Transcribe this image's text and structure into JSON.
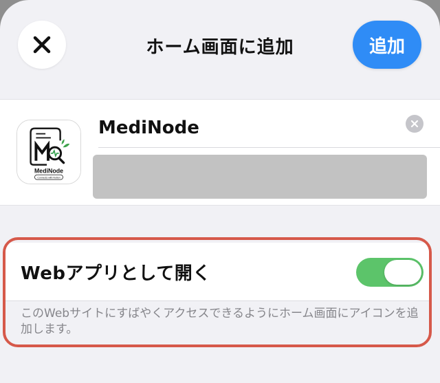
{
  "header": {
    "title": "ホーム画面に追加",
    "add_label": "追加",
    "close_icon": "close-icon"
  },
  "app": {
    "name_value": "MediNode",
    "icon_text": "MediNode",
    "icon_tagline": "Connects with Notion",
    "clear_icon": "clear-icon"
  },
  "options": {
    "open_as_web_app_label": "Webアプリとして開く",
    "open_as_web_app_enabled": true,
    "footnote": "このWebサイトにすばやくアクセスできるようにホーム画面にアイコンを追加します。"
  },
  "colors": {
    "accent": "#2f8cf6",
    "toggle_on": "#5cc46a",
    "highlight": "#d6594a"
  }
}
